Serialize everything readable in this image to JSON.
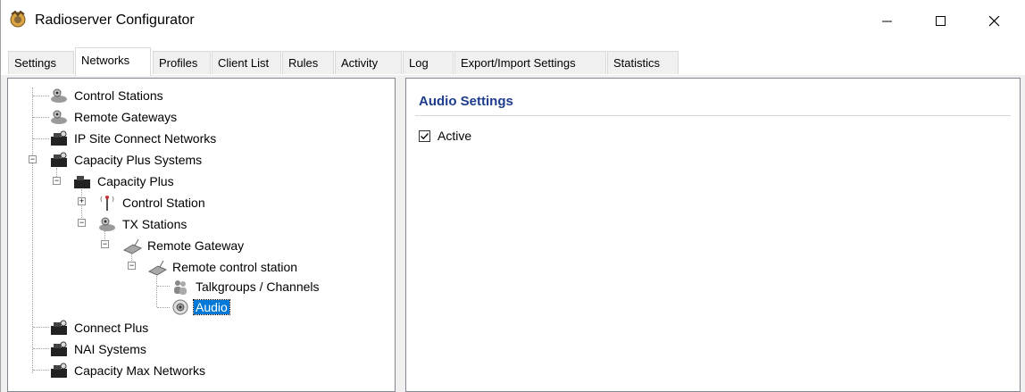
{
  "window": {
    "title": "Radioserver Configurator",
    "icon": "radio-app-icon",
    "controls": {
      "minimize": "minimize-icon",
      "maximize": "maximize-icon",
      "close": "close-icon"
    }
  },
  "tabs": [
    {
      "label": "Settings",
      "active": false
    },
    {
      "label": "Networks",
      "active": true
    },
    {
      "label": "Profiles",
      "active": false
    },
    {
      "label": "Client List",
      "active": false
    },
    {
      "label": "Rules",
      "active": false
    },
    {
      "label": "Activity",
      "active": false
    },
    {
      "label": "Log",
      "active": false
    },
    {
      "label": "Export/Import Settings",
      "active": false
    },
    {
      "label": "Statistics",
      "active": false
    }
  ],
  "tree": {
    "items": [
      {
        "label": "Control Stations",
        "icon": "stations-icon"
      },
      {
        "label": "Remote Gateways",
        "icon": "stations-icon"
      },
      {
        "label": "IP Site Connect Networks",
        "icon": "network-icon"
      },
      {
        "label": "Capacity Plus Systems",
        "icon": "network-icon",
        "expanded": true
      },
      {
        "label": "Capacity Plus",
        "icon": "network-icon",
        "expanded": true
      },
      {
        "label": "Control Station",
        "icon": "antenna-icon",
        "expanded": false
      },
      {
        "label": "TX Stations",
        "icon": "stations-icon",
        "expanded": true
      },
      {
        "label": "Remote Gateway",
        "icon": "gateway-icon",
        "expanded": true
      },
      {
        "label": "Remote control station",
        "icon": "gateway-icon",
        "expanded": true
      },
      {
        "label": "Talkgroups / Channels",
        "icon": "users-icon"
      },
      {
        "label": "Audio",
        "icon": "speaker-icon",
        "selected": true
      },
      {
        "label": "Connect Plus",
        "icon": "network-icon"
      },
      {
        "label": "NAI Systems",
        "icon": "network-icon"
      },
      {
        "label": "Capacity Max Networks",
        "icon": "network-icon"
      }
    ]
  },
  "audio_settings": {
    "title": "Audio Settings",
    "active_label": "Active",
    "active_checked": true
  },
  "colors": {
    "section_title": "#1e3c8c",
    "selection": "#0078d7"
  }
}
